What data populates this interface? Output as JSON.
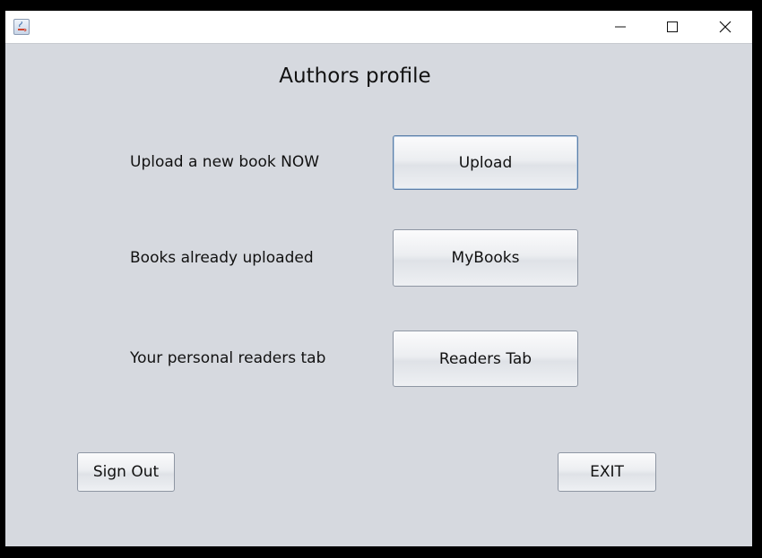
{
  "window": {
    "controls": {
      "minimize_icon": "minimize-icon",
      "maximize_icon": "maximize-icon",
      "close_icon": "close-icon"
    }
  },
  "main": {
    "title": "Authors profile",
    "rows": [
      {
        "label": "Upload a new book NOW",
        "button": "Upload"
      },
      {
        "label": "Books already uploaded",
        "button": "MyBooks"
      },
      {
        "label": "Your personal readers tab",
        "button": "Readers Tab"
      }
    ]
  },
  "footer": {
    "sign_out": "Sign Out",
    "exit": "EXIT"
  },
  "colors": {
    "background": "#d6d9df",
    "titlebar": "#ffffff",
    "focus_border": "#5c7fa8"
  }
}
